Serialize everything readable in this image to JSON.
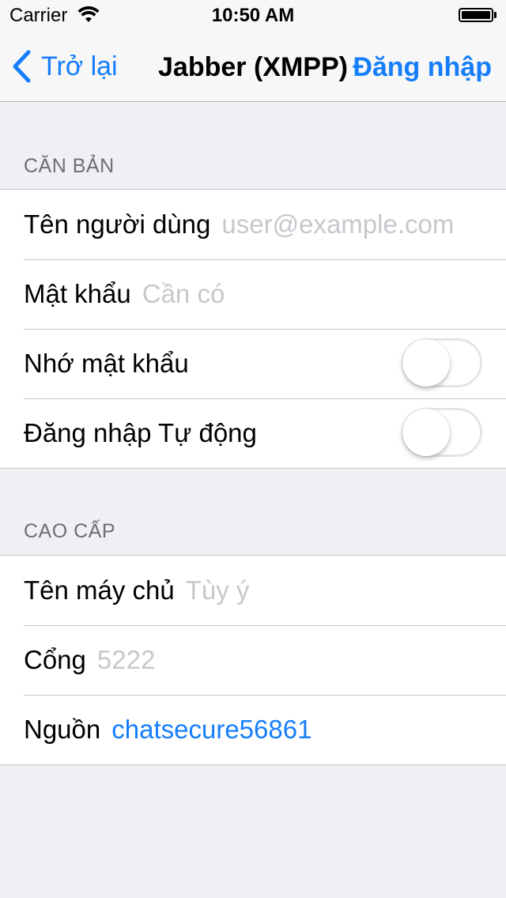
{
  "status_bar": {
    "carrier": "Carrier",
    "time": "10:50 AM"
  },
  "nav": {
    "back_label": "Trở lại",
    "title": "Jabber (XMPP)",
    "right_action": "Đăng nhập"
  },
  "basic": {
    "header": "CĂN BẢN",
    "username_label": "Tên người dùng",
    "username_placeholder": "user@example.com",
    "password_label": "Mật khẩu",
    "password_placeholder": "Cần có",
    "remember_label": "Nhớ mật khẩu",
    "remember_on": false,
    "autologin_label": "Đăng nhập Tự động",
    "autologin_on": false
  },
  "advanced": {
    "header": "CAO CẤP",
    "hostname_label": "Tên máy chủ",
    "hostname_placeholder": "Tùy ý",
    "port_label": "Cổng",
    "port_placeholder": "5222",
    "resource_label": "Nguồn",
    "resource_value": "chatsecure56861"
  },
  "colors": {
    "accent": "#157efb",
    "background": "#efeff4",
    "placeholder": "#c7c7cd",
    "section_header": "#6d6d72"
  }
}
